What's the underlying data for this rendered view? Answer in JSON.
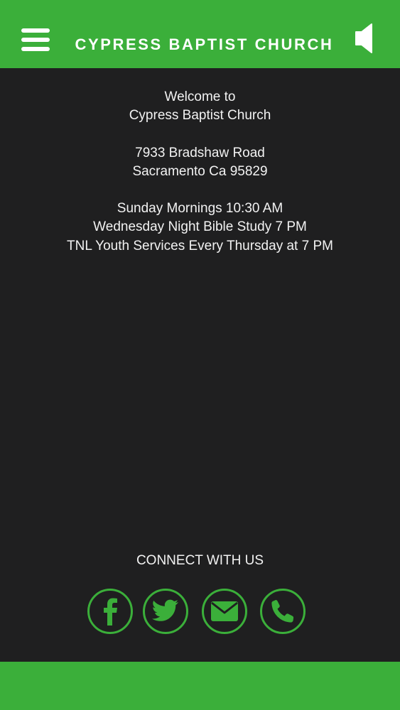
{
  "header": {
    "title": "CYPRESS BAPTIST CHURCH",
    "menu_icon": "hamburger-menu-icon",
    "audio_icon": "speaker-icon"
  },
  "welcome": {
    "line1": "Welcome to",
    "line2": "Cypress Baptist Church"
  },
  "address": {
    "street": "7933 Bradshaw Road",
    "city": "Sacramento Ca 95829"
  },
  "services": [
    "Sunday Mornings 10:30 AM",
    "Wednesday Night Bible Study 7 PM",
    "TNL Youth Services Every Thursday at 7 PM"
  ],
  "connect": {
    "title": "CONNECT WITH US",
    "icons": [
      "facebook-icon",
      "twitter-icon",
      "email-icon",
      "phone-icon"
    ]
  },
  "colors": {
    "accent": "#3baf3a",
    "background": "#1f1f20",
    "text": "#f2f2f2"
  }
}
